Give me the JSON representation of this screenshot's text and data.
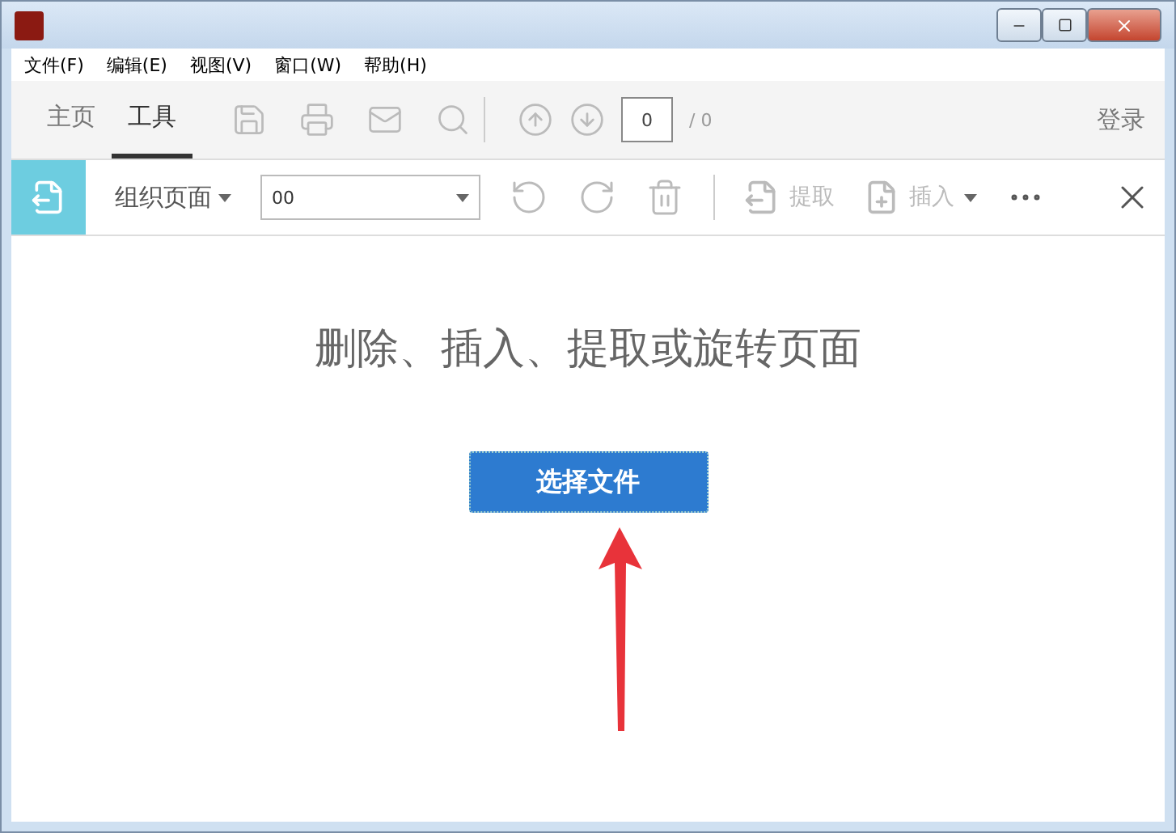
{
  "menu": [
    "文件(F)",
    "编辑(E)",
    "视图(V)",
    "窗口(W)",
    "帮助(H)"
  ],
  "tabs": [
    {
      "label": "主页",
      "selected": false
    },
    {
      "label": "工具",
      "selected": true
    }
  ],
  "page_nav": {
    "value": "0",
    "total": "/ 0"
  },
  "sign_in": "登录",
  "tool_bar": {
    "title": "组织页面",
    "range": "00",
    "extract": "提取",
    "insert": "插入"
  },
  "content": {
    "heading": "删除、插入、提取或旋转页面",
    "button": "选择文件"
  }
}
